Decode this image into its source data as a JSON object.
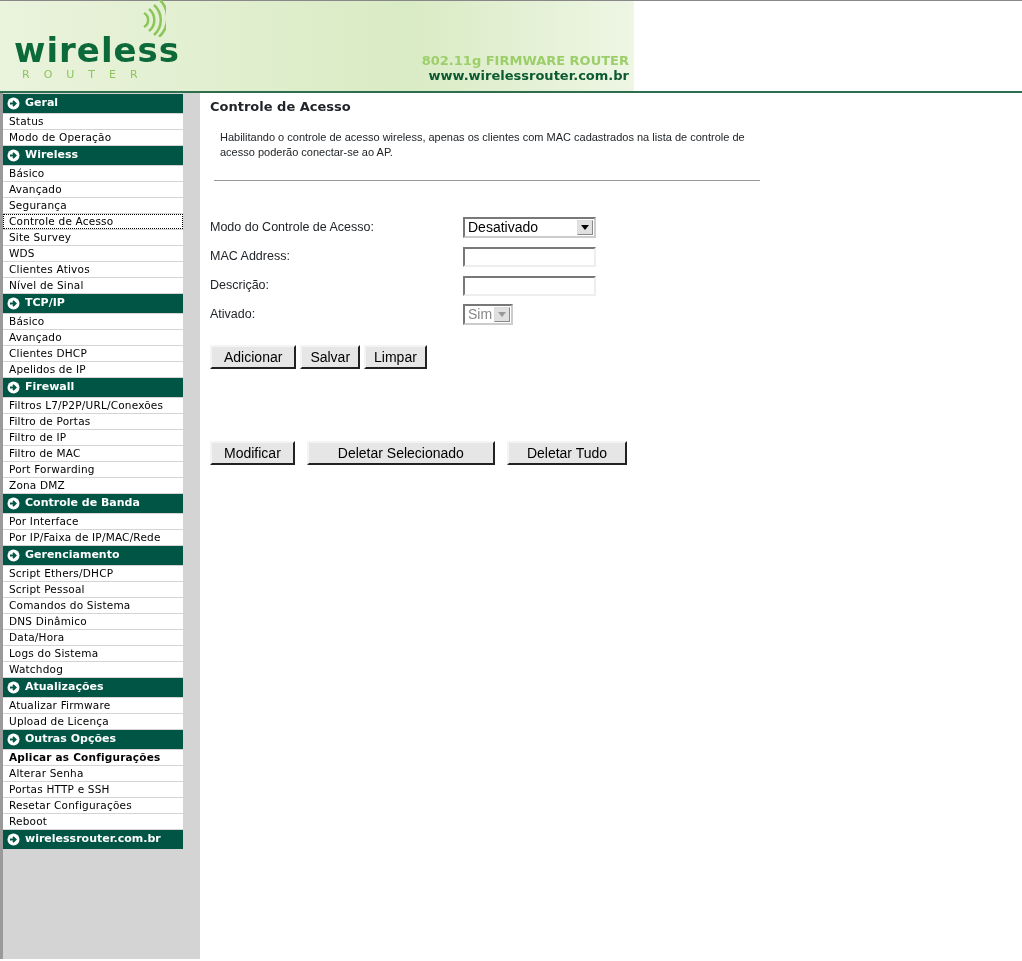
{
  "header": {
    "logo_word": "wireless",
    "logo_subword": "ROUTER",
    "tagline": "802.11g FIRMWARE ROUTER",
    "url": "www.wirelessrouter.com.br"
  },
  "sidebar": {
    "sections": [
      {
        "title": "Geral",
        "items": [
          {
            "label": "Status",
            "selected": false,
            "kind": "link"
          },
          {
            "label": "Modo de Operação",
            "selected": false,
            "kind": "link"
          }
        ]
      },
      {
        "title": "Wireless",
        "items": [
          {
            "label": "Básico",
            "selected": false,
            "kind": "link"
          },
          {
            "label": "Avançado",
            "selected": false,
            "kind": "link"
          },
          {
            "label": "Segurança",
            "selected": false,
            "kind": "link"
          },
          {
            "label": "Controle de Acesso",
            "selected": true,
            "kind": "link"
          },
          {
            "label": "Site Survey",
            "selected": false,
            "kind": "link"
          },
          {
            "label": "WDS",
            "selected": false,
            "kind": "link"
          },
          {
            "label": "Clientes Ativos",
            "selected": false,
            "kind": "link"
          },
          {
            "label": "Nível de Sinal",
            "selected": false,
            "kind": "link"
          }
        ]
      },
      {
        "title": "TCP/IP",
        "items": [
          {
            "label": "Básico",
            "selected": false,
            "kind": "link"
          },
          {
            "label": "Avançado",
            "selected": false,
            "kind": "link"
          },
          {
            "label": "Clientes DHCP",
            "selected": false,
            "kind": "link"
          },
          {
            "label": "Apelidos de IP",
            "selected": false,
            "kind": "link"
          }
        ]
      },
      {
        "title": "Firewall",
        "items": [
          {
            "label": "Filtros L7/P2P/URL/Conexões",
            "selected": false,
            "kind": "link"
          },
          {
            "label": "Filtro de Portas",
            "selected": false,
            "kind": "link"
          },
          {
            "label": "Filtro de IP",
            "selected": false,
            "kind": "link"
          },
          {
            "label": "Filtro de MAC",
            "selected": false,
            "kind": "link"
          },
          {
            "label": "Port Forwarding",
            "selected": false,
            "kind": "link"
          },
          {
            "label": "Zona DMZ",
            "selected": false,
            "kind": "link"
          }
        ]
      },
      {
        "title": "Controle de Banda",
        "items": [
          {
            "label": "Por Interface",
            "selected": false,
            "kind": "link"
          },
          {
            "label": "Por IP/Faixa de IP/MAC/Rede",
            "selected": false,
            "kind": "link"
          }
        ]
      },
      {
        "title": "Gerenciamento",
        "items": [
          {
            "label": "Script Ethers/DHCP",
            "selected": false,
            "kind": "link"
          },
          {
            "label": "Script Pessoal",
            "selected": false,
            "kind": "link"
          },
          {
            "label": "Comandos do Sistema",
            "selected": false,
            "kind": "link"
          },
          {
            "label": "DNS Dinâmico",
            "selected": false,
            "kind": "link"
          },
          {
            "label": "Data/Hora",
            "selected": false,
            "kind": "link"
          },
          {
            "label": "Logs do Sistema",
            "selected": false,
            "kind": "link"
          },
          {
            "label": "Watchdog",
            "selected": false,
            "kind": "link"
          }
        ]
      },
      {
        "title": "Atualizações",
        "items": [
          {
            "label": "Atualizar Firmware",
            "selected": false,
            "kind": "link"
          },
          {
            "label": "Upload de Licença",
            "selected": false,
            "kind": "link"
          }
        ]
      },
      {
        "title": "Outras Opções",
        "items": [
          {
            "label": "Aplicar as Configurações",
            "selected": false,
            "kind": "action"
          },
          {
            "label": "Alterar Senha",
            "selected": false,
            "kind": "link"
          },
          {
            "label": "Portas HTTP e SSH",
            "selected": false,
            "kind": "link"
          },
          {
            "label": "Resetar Configurações",
            "selected": false,
            "kind": "link"
          },
          {
            "label": "Reboot",
            "selected": false,
            "kind": "link"
          }
        ]
      },
      {
        "title": "wirelessrouter.com.br"
      }
    ]
  },
  "content": {
    "title": "Controle de Acesso",
    "description": "Habilitando o controle de acesso wireless, apenas os clientes com MAC cadastrados na lista de controle de acesso poderão conectar-se ao AP.",
    "fields": [
      {
        "label": "Modo do Controle de Acesso:",
        "kind": "select",
        "value": "Desativado",
        "disabled": false
      },
      {
        "label": "MAC Address:",
        "kind": "text"
      },
      {
        "label": "Descrição:",
        "kind": "text"
      },
      {
        "label": "Ativado:",
        "kind": "select",
        "value": "Sim",
        "disabled": true
      }
    ],
    "form_buttons": [
      "Adicionar",
      "Salvar",
      "Limpar"
    ],
    "table_buttons": [
      "Modificar",
      "Deletar Selecionado",
      "Deletar Tudo"
    ]
  }
}
